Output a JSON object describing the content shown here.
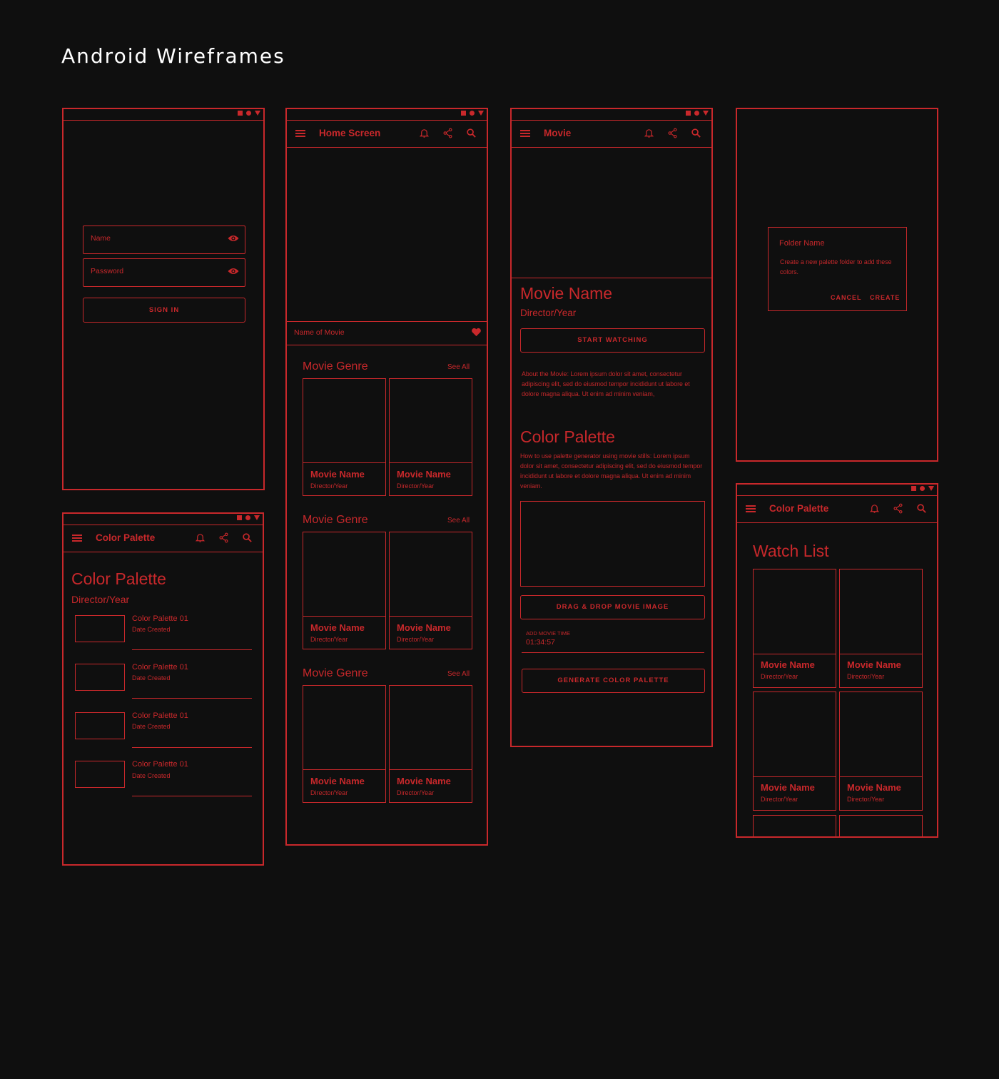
{
  "page_title": "Android Wireframes",
  "accent_color": "#c8282b",
  "background_color": "#0f0f0f",
  "login": {
    "name_placeholder": "Name",
    "password_placeholder": "Password",
    "sign_in_label": "SIGN IN"
  },
  "home": {
    "appbar_title": "Home Screen",
    "featured_label": "Name of Movie",
    "sections": [
      {
        "title": "Movie Genre",
        "see_all": "See All",
        "cards": [
          {
            "name": "Movie Name",
            "sub": "Director/Year"
          },
          {
            "name": "Movie Name",
            "sub": "Director/Year"
          }
        ]
      },
      {
        "title": "Movie Genre",
        "see_all": "See All",
        "cards": [
          {
            "name": "Movie Name",
            "sub": "Director/Year"
          },
          {
            "name": "Movie Name",
            "sub": "Director/Year"
          }
        ]
      },
      {
        "title": "Movie Genre",
        "see_all": "See All",
        "cards": [
          {
            "name": "Movie Name",
            "sub": "Director/Year"
          },
          {
            "name": "Movie Name",
            "sub": "Director/Year"
          }
        ]
      }
    ]
  },
  "movie": {
    "appbar_title": "Movie",
    "title": "Movie Name",
    "subtitle": "Director/Year",
    "start_label": "START WATCHING",
    "about": "About the Movie: Lorem ipsum dolor sit amet, consectetur adipiscing elit, sed do eiusmod tempor incididunt ut labore et dolore magna aliqua. Ut enim ad minim veniam,",
    "palette_title": "Color Palette",
    "palette_desc": "How to use palette generator using movie stills: Lorem ipsum dolor sit amet, consectetur adipiscing elit, sed do eiusmod tempor incididunt ut labore et dolore magna aliqua. Ut enim ad minim veniam.",
    "drag_label": "DRAG & DROP MOVIE IMAGE",
    "time_label": "ADD MOVIE TIME",
    "time_value": "01:34:57",
    "generate_label": "GENERATE COLOR PALETTE"
  },
  "dialog": {
    "title": "Folder Name",
    "body": "Create a new palette folder to add these colors.",
    "cancel_label": "CANCEL",
    "create_label": "CREATE"
  },
  "palette_screen": {
    "appbar_title": "Color Palette",
    "title": "Color Palette",
    "subtitle": "Director/Year",
    "items": [
      {
        "name": "Color Palette 01",
        "date": "Date Created"
      },
      {
        "name": "Color Palette 01",
        "date": "Date Created"
      },
      {
        "name": "Color Palette 01",
        "date": "Date Created"
      },
      {
        "name": "Color Palette 01",
        "date": "Date Created"
      }
    ]
  },
  "watchlist": {
    "appbar_title": "Color Palette",
    "title": "Watch List",
    "cards": [
      {
        "name": "Movie Name",
        "sub": "Director/Year"
      },
      {
        "name": "Movie Name",
        "sub": "Director/Year"
      },
      {
        "name": "Movie Name",
        "sub": "Director/Year"
      },
      {
        "name": "Movie Name",
        "sub": "Director/Year"
      }
    ]
  }
}
